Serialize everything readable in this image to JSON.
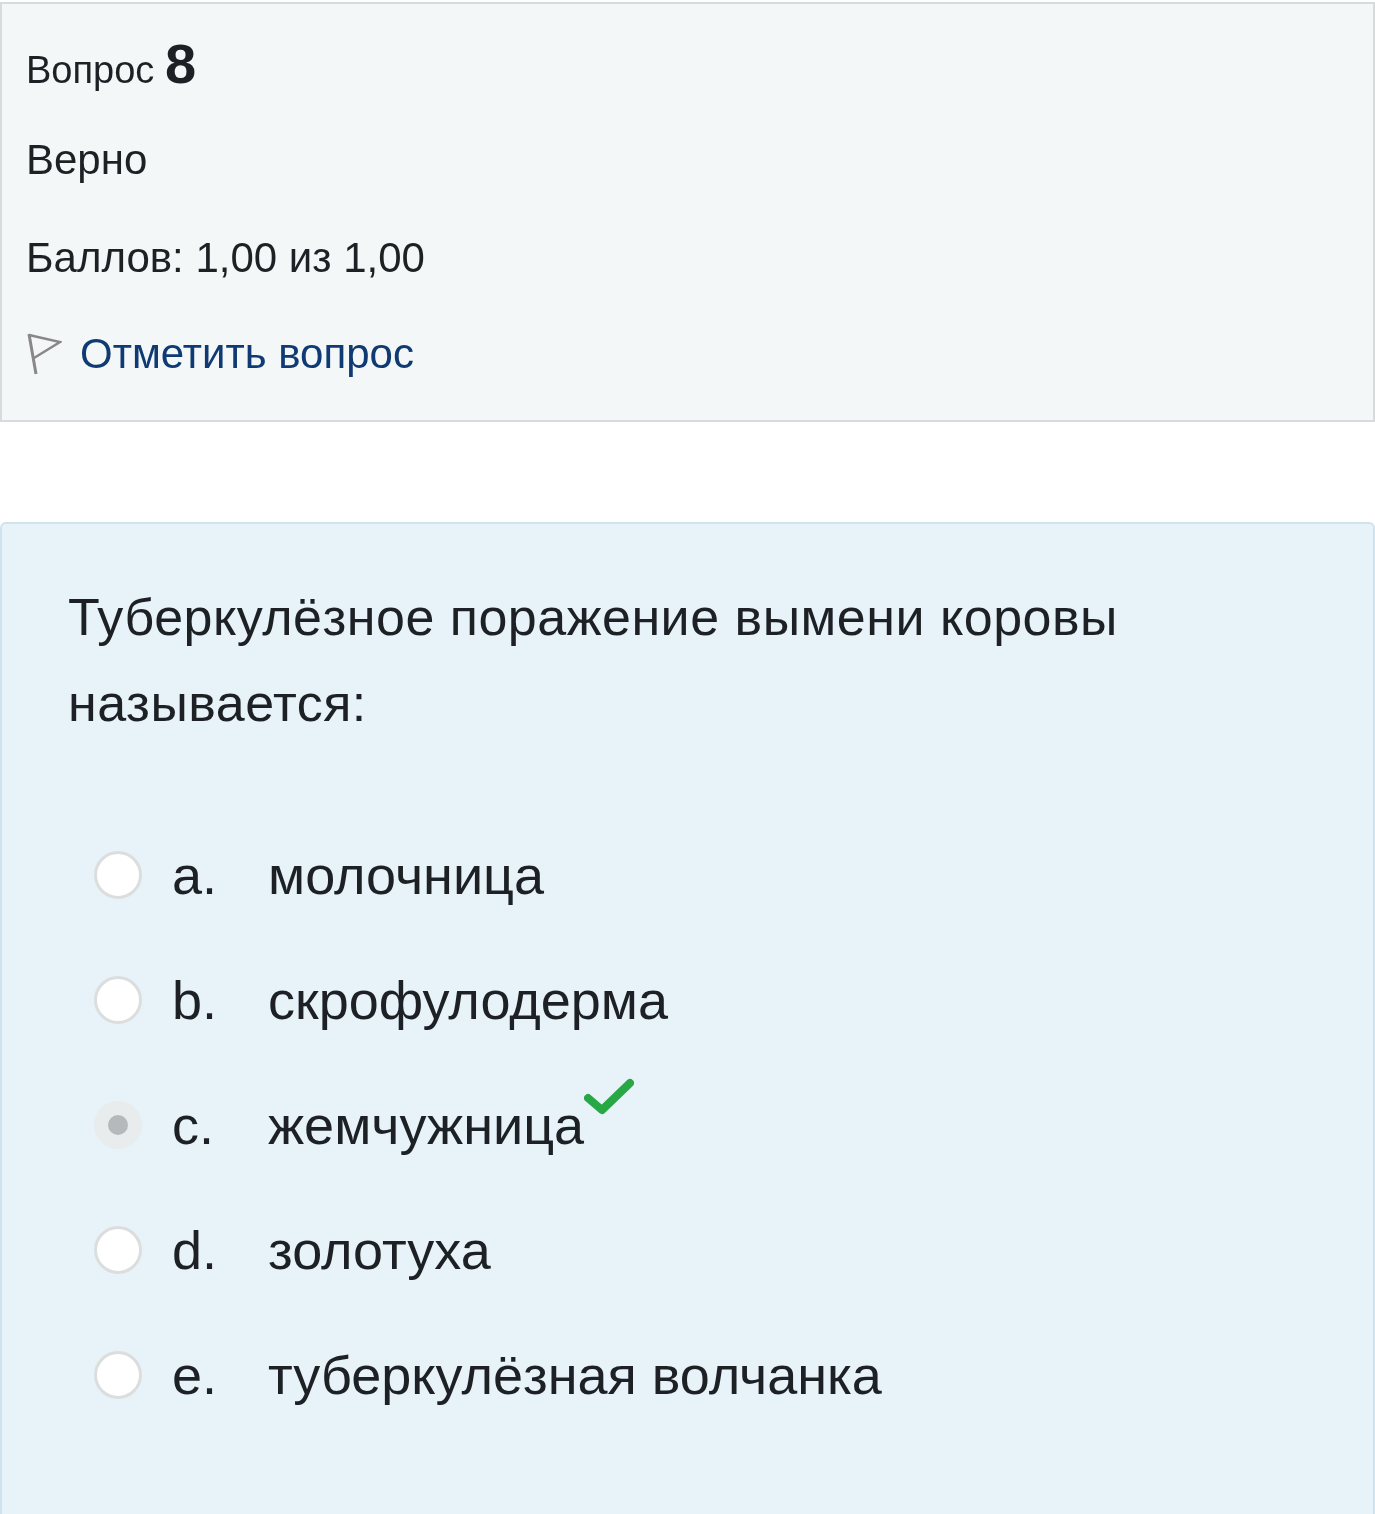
{
  "info": {
    "label": "Вопрос",
    "number": "8",
    "state": "Верно",
    "grade": "Баллов: 1,00 из 1,00",
    "flag_link": "Отметить вопрос",
    "flagged": false
  },
  "question": {
    "text": "Туберкулёзное поражение вымени коровы называется:",
    "options": [
      {
        "letter": "a.",
        "text": "молочница",
        "selected": false,
        "correct": false
      },
      {
        "letter": "b.",
        "text": "скрофулодерма",
        "selected": false,
        "correct": false
      },
      {
        "letter": "c.",
        "text": "жемчужница",
        "selected": true,
        "correct": true
      },
      {
        "letter": "d.",
        "text": "золотуха",
        "selected": false,
        "correct": false
      },
      {
        "letter": "e.",
        "text": "туберкулёзная волчанка",
        "selected": false,
        "correct": false
      }
    ]
  }
}
